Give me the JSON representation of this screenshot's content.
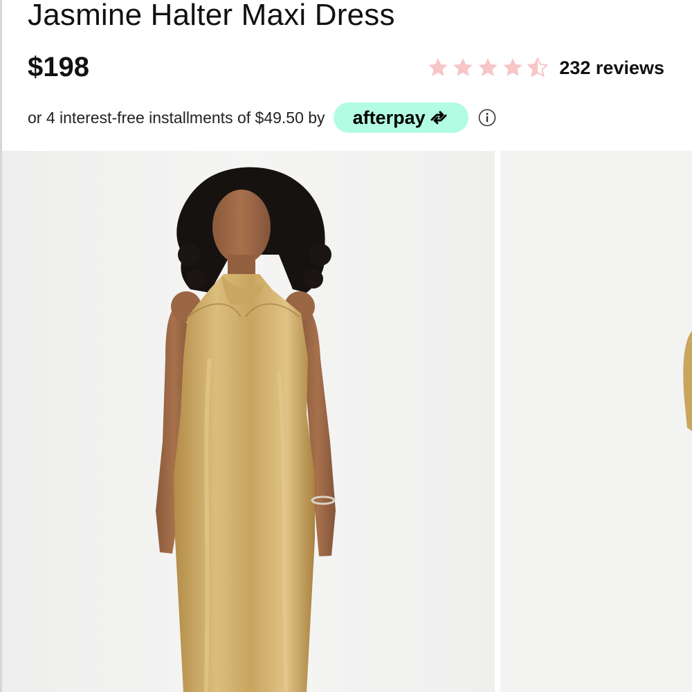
{
  "product": {
    "title": "Jasmine Halter Maxi Dress",
    "price": "$198"
  },
  "rating": {
    "value": 4.5,
    "out_of": 5,
    "reviews_label": "232 reviews",
    "star_color": "#f7c6c7"
  },
  "installments": {
    "text": "or 4 interest-free installments of $49.50 by",
    "provider": "afterpay",
    "badge_color": "#b2fce4",
    "info_icon": "info-circle-icon"
  },
  "gallery": {
    "images": [
      {
        "name": "model-wearing-gold-satin-halter-maxi-dress-front"
      },
      {
        "name": "model-wearing-gold-satin-halter-maxi-dress-partial"
      }
    ],
    "dress_color": "#c9a55f",
    "background_color": "#f1f1f0"
  }
}
